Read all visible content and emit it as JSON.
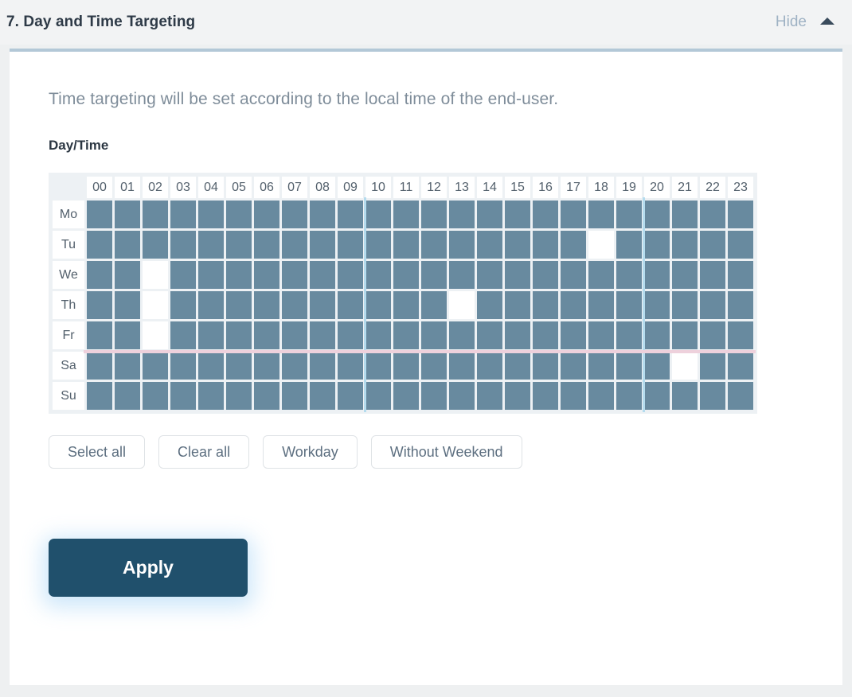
{
  "header": {
    "title": "7. Day and Time Targeting",
    "hide_label": "Hide",
    "chevron_icon": "chevron-up-icon"
  },
  "content": {
    "intro": "Time targeting will be set according to the local time of the end-user.",
    "field_label": "Day/Time"
  },
  "grid": {
    "hours": [
      "00",
      "01",
      "02",
      "03",
      "04",
      "05",
      "06",
      "07",
      "08",
      "09",
      "10",
      "11",
      "12",
      "13",
      "14",
      "15",
      "16",
      "17",
      "18",
      "19",
      "20",
      "21",
      "22",
      "23"
    ],
    "days": [
      "Mo",
      "Tu",
      "We",
      "Th",
      "Fr",
      "Sa",
      "Su"
    ],
    "selected": {
      "Mo": [
        1,
        1,
        1,
        1,
        1,
        1,
        1,
        1,
        1,
        1,
        1,
        1,
        1,
        1,
        1,
        1,
        1,
        1,
        1,
        1,
        1,
        1,
        1,
        1
      ],
      "Tu": [
        1,
        1,
        1,
        1,
        1,
        1,
        1,
        1,
        1,
        1,
        1,
        1,
        1,
        1,
        1,
        1,
        1,
        1,
        0,
        1,
        1,
        1,
        1,
        1
      ],
      "We": [
        1,
        1,
        0,
        1,
        1,
        1,
        1,
        1,
        1,
        1,
        1,
        1,
        1,
        1,
        1,
        1,
        1,
        1,
        1,
        1,
        1,
        1,
        1,
        1
      ],
      "Th": [
        1,
        1,
        0,
        1,
        1,
        1,
        1,
        1,
        1,
        1,
        1,
        1,
        1,
        0,
        1,
        1,
        1,
        1,
        1,
        1,
        1,
        1,
        1,
        1
      ],
      "Fr": [
        1,
        1,
        0,
        1,
        1,
        1,
        1,
        1,
        1,
        1,
        1,
        1,
        1,
        1,
        1,
        1,
        1,
        1,
        1,
        1,
        1,
        1,
        1,
        1
      ],
      "Sa": [
        1,
        1,
        1,
        1,
        1,
        1,
        1,
        1,
        1,
        1,
        1,
        1,
        1,
        1,
        1,
        1,
        1,
        1,
        1,
        1,
        1,
        0,
        1,
        1
      ],
      "Su": [
        1,
        1,
        1,
        1,
        1,
        1,
        1,
        1,
        1,
        1,
        1,
        1,
        1,
        1,
        1,
        1,
        1,
        1,
        1,
        1,
        1,
        1,
        1,
        1
      ]
    },
    "vertical_dividers_after_hour": [
      9,
      19
    ],
    "horizontal_divider_after_day": "Fr",
    "colors": {
      "cell_selected": "#688a9f",
      "cell_empty": "#ffffff",
      "grid_background": "#edf1f4",
      "vertical_divider": "#b5dcee",
      "horizontal_divider": "#eed1dc"
    }
  },
  "presets": [
    {
      "label": "Select all",
      "name": "select-all"
    },
    {
      "label": "Clear all",
      "name": "clear-all"
    },
    {
      "label": "Workday",
      "name": "workday"
    },
    {
      "label": "Without Weekend",
      "name": "without-weekend"
    }
  ],
  "apply": {
    "label": "Apply",
    "color": "#20506c"
  }
}
